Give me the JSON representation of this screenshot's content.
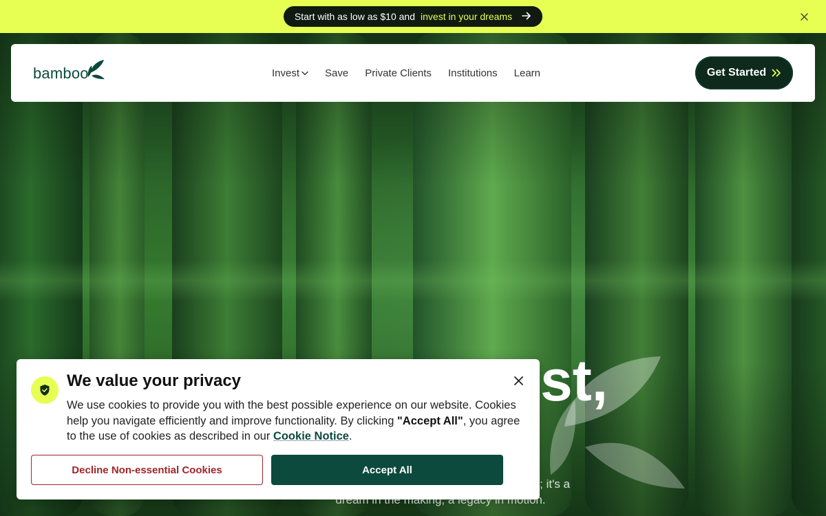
{
  "announcement": {
    "text_start": "Start with as low as $10 and",
    "text_highlight": "invest in your dreams",
    "arrow_icon": "arrow-right-icon",
    "close_icon": "close-icon"
  },
  "nav": {
    "logo_text": "bamboo",
    "links": [
      {
        "label": "Invest",
        "has_dropdown": true
      },
      {
        "label": "Save"
      },
      {
        "label": "Private Clients"
      },
      {
        "label": "Institutions"
      },
      {
        "label": "Learn"
      }
    ],
    "cta_label": "Get Started",
    "cta_icon": "double-chevron-right-icon"
  },
  "hero": {
    "title_visible": "st,",
    "subtitle_part1": "r; it's a",
    "subtitle_part2": "dream in the making, a legacy in motion."
  },
  "cookie": {
    "title": "We value your privacy",
    "icon": "shield-check-icon",
    "body_part1": "We use cookies to provide you with the best possible experience on our website. Cookies help you navigate efficiently and improve functionality. By clicking ",
    "body_bold": "\"Accept All\"",
    "body_part2": ", you agree to the use of cookies as described in our ",
    "link_text": "Cookie Notice",
    "body_end": ".",
    "decline_label": "Decline Non-essential Cookies",
    "accept_label": "Accept All",
    "close_icon": "close-icon"
  },
  "colors": {
    "accent_yellow": "#e6ff52",
    "brand_green": "#0b4a3c",
    "decline_red": "#a0252a",
    "cta_dark": "#0d2a1c"
  }
}
